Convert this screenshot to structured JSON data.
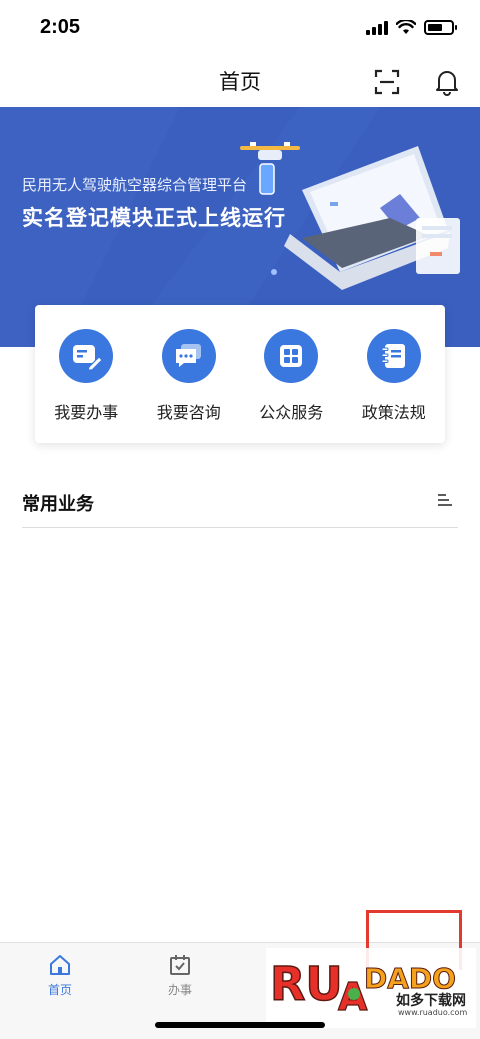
{
  "status_bar": {
    "time": "2:05"
  },
  "nav": {
    "title": "首页"
  },
  "banner": {
    "subtitle": "民用无人驾驶航空器综合管理平台",
    "headline": "实名登记模块正式上线运行"
  },
  "quick_actions": [
    {
      "label": "我要办事",
      "icon": "edit-doc-icon"
    },
    {
      "label": "我要咨询",
      "icon": "chat-icon"
    },
    {
      "label": "公众服务",
      "icon": "grid-icon"
    },
    {
      "label": "政策法规",
      "icon": "notebook-icon"
    }
  ],
  "common_business": {
    "title": "常用业务"
  },
  "tab_bar": {
    "tabs": [
      {
        "label": "首页",
        "icon": "home-icon",
        "active": true
      },
      {
        "label": "办事",
        "icon": "calendar-check-icon",
        "active": false
      }
    ]
  },
  "watermark": {
    "logo": "RUANDADO",
    "sub": "如多下载网",
    "url": "www.ruaduo.com"
  },
  "colors": {
    "accent": "#3a78df",
    "banner": "#3a5fbf",
    "highlight": "#e23a2e"
  }
}
